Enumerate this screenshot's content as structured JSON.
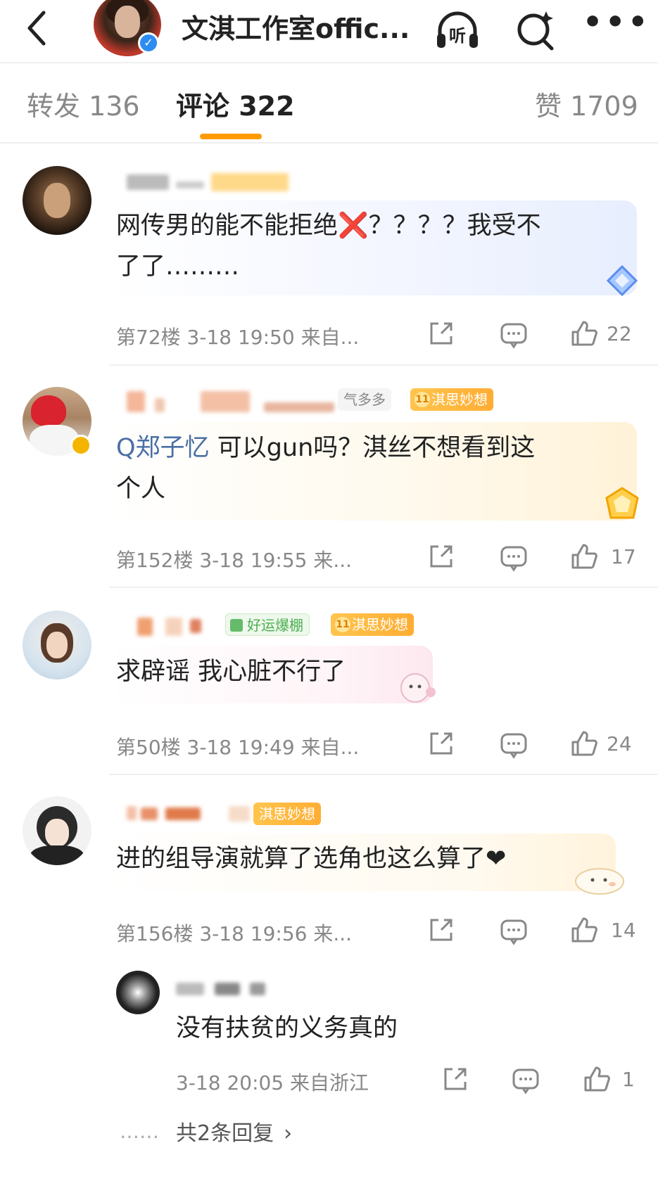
{
  "header": {
    "account_name": "文淇工作室offic...",
    "listen_label": "听"
  },
  "tabs": {
    "repost": "转发 136",
    "comments": "评论 322",
    "likes": "赞 1709"
  },
  "comments": [
    {
      "text_line1": "网传男的能不能拒绝❌？？？？我受不",
      "text_line2": "了了………",
      "meta": "第72楼 3-18 19:50 来自...",
      "likes": "22"
    },
    {
      "badge1": "气多多",
      "badge2": "淇思妙想",
      "badge2_level": "11",
      "mention": "Q郑子忆",
      "text_line1_rest": " 可以gun吗？淇丝不想看到这",
      "text_line2": "个人",
      "meta": "第152楼 3-18 19:55 来...",
      "likes": "17"
    },
    {
      "badge1": "好运爆棚",
      "badge2": "淇思妙想",
      "badge2_level": "11",
      "text_line1": "求辟谣 我心脏不行了",
      "meta": "第50楼 3-18 19:49 来自...",
      "likes": "24"
    },
    {
      "badge1": "淇思妙想",
      "text_line1": "进的组导演就算了选角也这么算了❤",
      "meta": "第156楼 3-18 19:56 来...",
      "likes": "14"
    }
  ],
  "reply": {
    "text": "没有扶贫的义务真的",
    "meta": "3-18 20:05 来自浙江",
    "likes": "1",
    "more_replies": "共2条回复",
    "dots": "……"
  },
  "colors": {
    "accent": "#ff9a00",
    "verified": "#2d8cf0",
    "mention": "#4a6fa5"
  },
  "icons": [
    "back-arrow-icon",
    "headphones-icon",
    "search-sparkle-icon",
    "more-dots-icon",
    "share-icon",
    "comment-icon",
    "like-icon"
  ]
}
